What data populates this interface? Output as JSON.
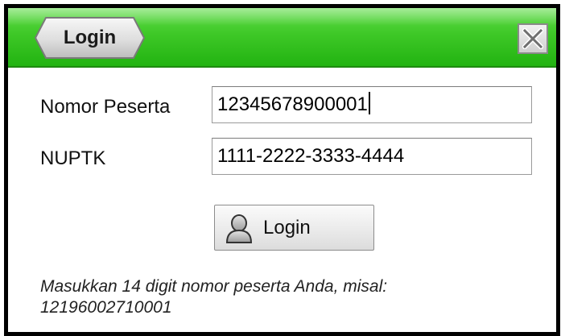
{
  "window": {
    "title": "Login",
    "close_icon": "close-icon"
  },
  "form": {
    "nomor_peserta": {
      "label": "Nomor Peserta",
      "value": "12345678900001"
    },
    "nuptk": {
      "label": "NUPTK",
      "value": "1111-2222-3333-4444"
    },
    "submit": {
      "label": "Login",
      "icon": "user-icon"
    },
    "hint_line1": "Masukkan 14 digit nomor peserta Anda, misal:",
    "hint_line2": "12196002710001"
  },
  "colors": {
    "titlebar_green": "#3ec827",
    "border": "#000000"
  }
}
